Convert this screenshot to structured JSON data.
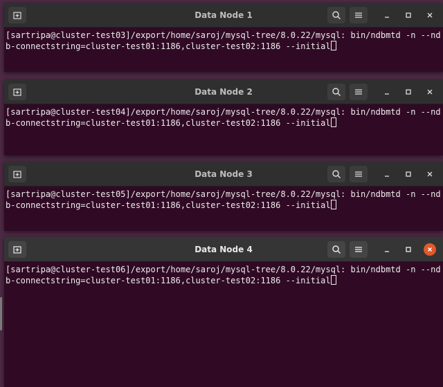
{
  "colors": {
    "terminal_bg": "#300a24",
    "desktop_bg": "#4d2a45",
    "close_active": "#e05a2b"
  },
  "windows": [
    {
      "title": "Data Node 1",
      "active": false,
      "line1": "[sartripa@cluster-test03]/export/home/saroj/mysql-tree/8.0.22/mysql: bin/ndbmtd -n --nd",
      "line2": "b-connectstring=cluster-test01:1186,cluster-test02:1186 --initial"
    },
    {
      "title": "Data Node 2",
      "active": false,
      "line1": "[sartripa@cluster-test04]/export/home/saroj/mysql-tree/8.0.22/mysql: bin/ndbmtd -n --nd",
      "line2": "b-connectstring=cluster-test01:1186,cluster-test02:1186 --initial"
    },
    {
      "title": "Data Node 3",
      "active": false,
      "line1": "[sartripa@cluster-test05]/export/home/saroj/mysql-tree/8.0.22/mysql: bin/ndbmtd -n --nd",
      "line2": "b-connectstring=cluster-test01:1186,cluster-test02:1186 --initial"
    },
    {
      "title": "Data Node 4",
      "active": true,
      "line1": "[sartripa@cluster-test06]/export/home/saroj/mysql-tree/8.0.22/mysql: bin/ndbmtd -n --nd",
      "line2": "b-connectstring=cluster-test01:1186,cluster-test02:1186 --initial"
    }
  ]
}
